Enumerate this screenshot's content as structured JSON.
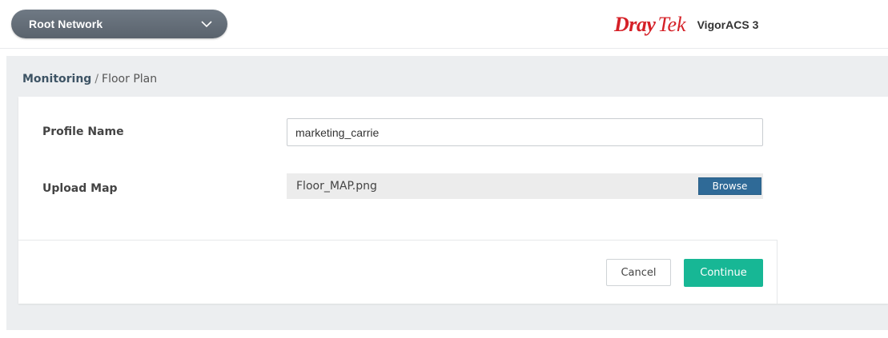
{
  "header": {
    "network_selector": {
      "value": "Root Network",
      "icon": "chevron-down-icon"
    },
    "brand": {
      "logo_primary": "Dray",
      "logo_secondary": "Tek",
      "product": "VigorACS 3",
      "logo_color": "#d52027"
    }
  },
  "breadcrumb": {
    "section": "Monitoring",
    "separator": "/",
    "page": "Floor Plan"
  },
  "form": {
    "profile_name": {
      "label": "Profile Name",
      "value": "marketing_carrie"
    },
    "upload_map": {
      "label": "Upload Map",
      "file_name": "Floor_MAP.png",
      "browse_label": "Browse"
    }
  },
  "actions": {
    "cancel_label": "Cancel",
    "continue_label": "Continue"
  },
  "colors": {
    "accent_continue": "#17b795",
    "browse_button": "#2f6a97",
    "selector_bg": "#5f6973"
  }
}
